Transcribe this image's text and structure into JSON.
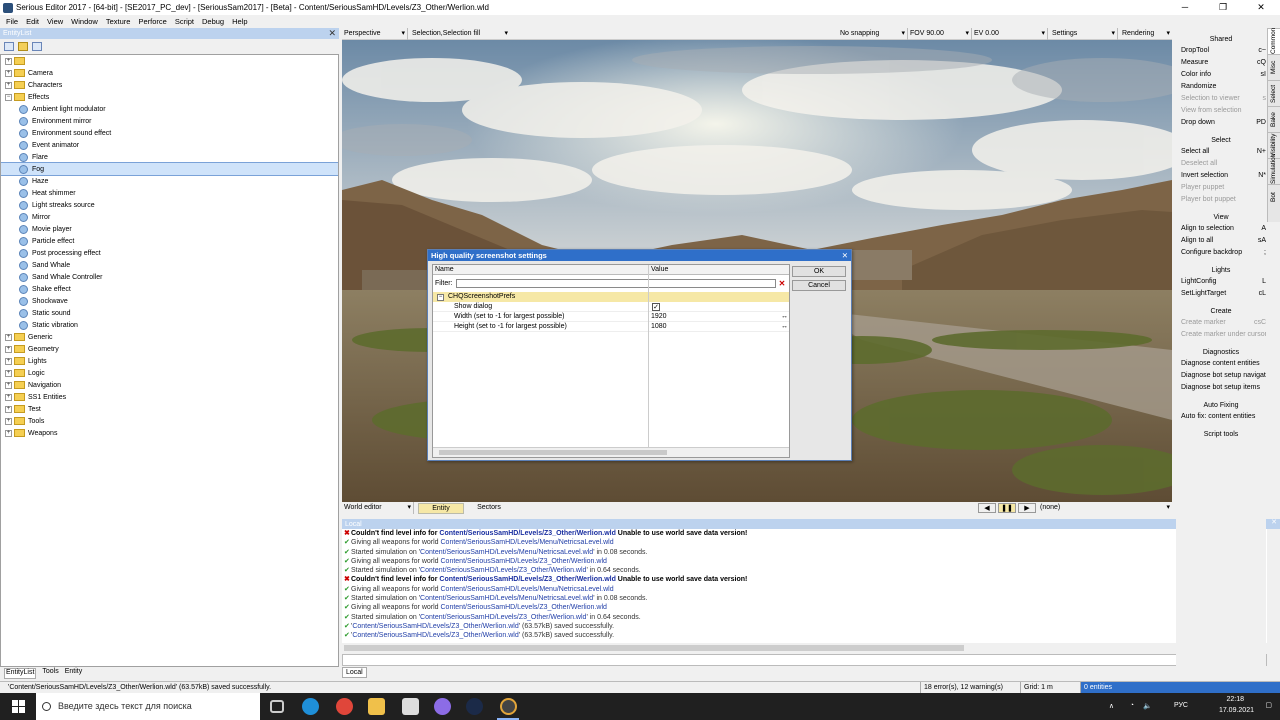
{
  "window": {
    "title": "Serious Editor 2017 - [64-bit] - [SE2017_PC_dev] - [SeriousSam2017] - [Beta] - Content/SeriousSamHD/Levels/Z3_Other/Werlion.wld"
  },
  "menu": [
    "File",
    "Edit",
    "View",
    "Window",
    "Texture",
    "Perforce",
    "Script",
    "Debug",
    "Help"
  ],
  "entity_list": {
    "header": "EntityList",
    "tree": [
      {
        "label": "",
        "type": "folder",
        "expanded": false
      },
      {
        "label": "Camera",
        "type": "folder",
        "expanded": false
      },
      {
        "label": "Characters",
        "type": "folder",
        "expanded": false
      },
      {
        "label": "Effects",
        "type": "folder",
        "expanded": true
      },
      {
        "label": "Ambient light modulator",
        "type": "entity"
      },
      {
        "label": "Environment mirror",
        "type": "entity"
      },
      {
        "label": "Environment sound effect",
        "type": "entity"
      },
      {
        "label": "Event animator",
        "type": "entity"
      },
      {
        "label": "Flare",
        "type": "entity"
      },
      {
        "label": "Fog",
        "type": "entity",
        "selected": true
      },
      {
        "label": "Haze",
        "type": "entity"
      },
      {
        "label": "Heat shimmer",
        "type": "entity"
      },
      {
        "label": "Light streaks source",
        "type": "entity"
      },
      {
        "label": "Mirror",
        "type": "entity"
      },
      {
        "label": "Movie player",
        "type": "entity"
      },
      {
        "label": "Particle effect",
        "type": "entity"
      },
      {
        "label": "Post processing effect",
        "type": "entity"
      },
      {
        "label": "Sand Whale",
        "type": "entity"
      },
      {
        "label": "Sand Whale Controller",
        "type": "entity"
      },
      {
        "label": "Shake effect",
        "type": "entity"
      },
      {
        "label": "Shockwave",
        "type": "entity"
      },
      {
        "label": "Static sound",
        "type": "entity"
      },
      {
        "label": "Static vibration",
        "type": "entity"
      },
      {
        "label": "Generic",
        "type": "folder",
        "expanded": false
      },
      {
        "label": "Geometry",
        "type": "folder",
        "expanded": false
      },
      {
        "label": "Lights",
        "type": "folder",
        "expanded": false
      },
      {
        "label": "Logic",
        "type": "folder",
        "expanded": false
      },
      {
        "label": "Navigation",
        "type": "folder",
        "expanded": false
      },
      {
        "label": "SS1 Entities",
        "type": "folder",
        "expanded": false
      },
      {
        "label": "Test",
        "type": "folder",
        "expanded": false
      },
      {
        "label": "Tools",
        "type": "folder",
        "expanded": false
      },
      {
        "label": "Weapons",
        "type": "folder",
        "expanded": false
      }
    ],
    "tabs": [
      "EntityList",
      "Tools",
      "Entity"
    ]
  },
  "viewport_toolbar": {
    "view": "Perspective",
    "selection": "Selection,Selection fill",
    "snapping": "No snapping",
    "fov": "FOV 90.00",
    "ev": "EV  0.00",
    "settings": "Settings",
    "rendering": "Rendering"
  },
  "viewport_bottom": {
    "mode": "World editor",
    "tabs": [
      "Entity",
      "Sectors"
    ],
    "playback_value": "(none)"
  },
  "dialog": {
    "title": "High quality screenshot settings",
    "col_name": "Name",
    "col_value": "Value",
    "filter_label": "Filter:",
    "category": "CHQScreenshotPrefs",
    "rows": [
      {
        "name": "Show dialog",
        "value": "",
        "checkbox": true
      },
      {
        "name": "Width (set to -1 for largest possible)",
        "value": "1920"
      },
      {
        "name": "Height (set to -1 for largest possible)",
        "value": "1080"
      }
    ],
    "ok": "OK",
    "cancel": "Cancel"
  },
  "log": {
    "header": "Local",
    "lines": [
      {
        "kind": "err",
        "pre": "Couldn't find level info for ",
        "path": "Content/SeriousSamHD/Levels/Z3_Other/Werlion.wld",
        "post": " Unable to use world save data version!"
      },
      {
        "kind": "ok",
        "pre": "Giving all weapons for world ",
        "path": "Content/SeriousSamHD/Levels/Menu/NetricsaLevel.wld",
        "post": ""
      },
      {
        "kind": "ok",
        "pre": "Started simulation on '",
        "path": "Content/SeriousSamHD/Levels/Menu/NetricsaLevel.wld",
        "post": "' in 0.08 seconds."
      },
      {
        "kind": "ok",
        "pre": "Giving all weapons for world ",
        "path": "Content/SeriousSamHD/Levels/Z3_Other/Werlion.wld",
        "post": ""
      },
      {
        "kind": "ok",
        "pre": "Started simulation on '",
        "path": "Content/SeriousSamHD/Levels/Z3_Other/Werlion.wld",
        "post": "' in 0.64 seconds."
      },
      {
        "kind": "err",
        "pre": "Couldn't find level info for ",
        "path": "Content/SeriousSamHD/Levels/Z3_Other/Werlion.wld",
        "post": " Unable to use world save data version!"
      },
      {
        "kind": "ok",
        "pre": "Giving all weapons for world ",
        "path": "Content/SeriousSamHD/Levels/Menu/NetricsaLevel.wld",
        "post": ""
      },
      {
        "kind": "ok",
        "pre": "Started simulation on '",
        "path": "Content/SeriousSamHD/Levels/Menu/NetricsaLevel.wld",
        "post": "' in 0.08 seconds."
      },
      {
        "kind": "ok",
        "pre": "Giving all weapons for world ",
        "path": "Content/SeriousSamHD/Levels/Z3_Other/Werlion.wld",
        "post": ""
      },
      {
        "kind": "ok",
        "pre": "Started simulation on '",
        "path": "Content/SeriousSamHD/Levels/Z3_Other/Werlion.wld",
        "post": "' in 0.64 seconds."
      },
      {
        "kind": "ok",
        "pre": "'",
        "path": "Content/SeriousSamHD/Levels/Z3_Other/Werlion.wld",
        "post": "' (63.57kB) saved successfully."
      },
      {
        "kind": "ok",
        "pre": "'",
        "path": "Content/SeriousSamHD/Levels/Z3_Other/Werlion.wld",
        "post": "' (63.57kB) saved successfully."
      }
    ],
    "tab": "Local"
  },
  "right_panel": {
    "sections": [
      {
        "title": "Shared",
        "items": [
          {
            "label": "DropTool",
            "key": "c~",
            "disabled": false
          },
          {
            "label": "Measure",
            "key": "cQ",
            "disabled": false
          },
          {
            "label": "Color info",
            "key": "sI",
            "disabled": false
          },
          {
            "label": "Randomize",
            "key": "",
            "disabled": false
          },
          {
            "label": "Selection to viewer",
            "key": "s",
            "disabled": true
          },
          {
            "label": "View from selection",
            "key": "",
            "disabled": true
          },
          {
            "label": "Drop down",
            "key": "PD",
            "disabled": false
          }
        ]
      },
      {
        "title": "Select",
        "items": [
          {
            "label": "Select all",
            "key": "N+",
            "disabled": false
          },
          {
            "label": "Deselect all",
            "key": "",
            "disabled": true
          },
          {
            "label": "Invert selection",
            "key": "N*",
            "disabled": false
          },
          {
            "label": "Player puppet",
            "key": "",
            "disabled": true
          },
          {
            "label": "Player bot puppet",
            "key": "",
            "disabled": true
          }
        ]
      },
      {
        "title": "View",
        "items": [
          {
            "label": "Align to selection",
            "key": "A",
            "disabled": false
          },
          {
            "label": "Align to all",
            "key": "sA",
            "disabled": false
          },
          {
            "label": "Configure backdrop",
            "key": ";",
            "disabled": false
          }
        ]
      },
      {
        "title": "Lights",
        "items": [
          {
            "label": "LightConfig",
            "key": "L",
            "disabled": false
          },
          {
            "label": "SetLightTarget",
            "key": "cL",
            "disabled": false
          }
        ]
      },
      {
        "title": "Create",
        "items": [
          {
            "label": "Create marker",
            "key": "csC",
            "disabled": true
          },
          {
            "label": "Create marker under cursor",
            "key": "",
            "disabled": true
          }
        ]
      },
      {
        "title": "Diagnostics",
        "items": [
          {
            "label": "Diagnose content entities",
            "key": "",
            "disabled": false
          },
          {
            "label": "Diagnose bot setup navigation",
            "key": "",
            "disabled": false
          },
          {
            "label": "Diagnose bot setup items",
            "key": "",
            "disabled": false
          }
        ]
      },
      {
        "title": "Auto Fixing",
        "items": [
          {
            "label": "Auto fix: content entities",
            "key": "",
            "disabled": false
          }
        ]
      },
      {
        "title": "Script tools",
        "items": []
      }
    ],
    "vertical_tabs": [
      "Common",
      "Misc",
      "Select",
      "Bake",
      "Visibility",
      "Simulation",
      "Bot"
    ]
  },
  "status": {
    "message": "'Content/SeriousSamHD/Levels/Z3_Other/Werlion.wld' (63.57kB) saved successfully.",
    "errors": "18 error(s), 12 warning(s)",
    "grid": "Grid: 1 m",
    "entities": "0 entities"
  },
  "taskbar": {
    "search_placeholder": "Введите здесь текст для поиска",
    "lang": "РУС",
    "time": "22:18",
    "date": "17.09.2021"
  },
  "colors": {
    "accent": "#2f6fc9",
    "panel_header": "#bcd2ee",
    "selection": "#cfe3fa"
  }
}
